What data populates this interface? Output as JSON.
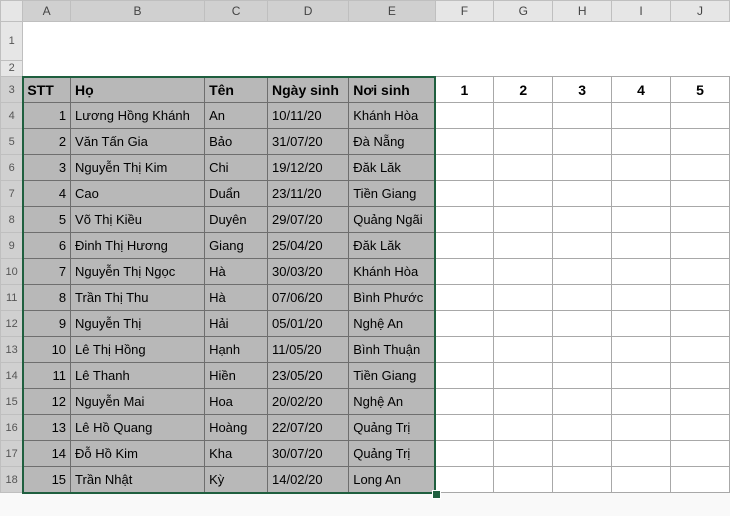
{
  "columns": [
    "A",
    "B",
    "C",
    "D",
    "E",
    "F",
    "G",
    "H",
    "I",
    "J"
  ],
  "header_row": {
    "stt": "STT",
    "ho": "Họ",
    "ten": "Tên",
    "ngaysinh": "Ngày sinh",
    "noisinh": "Nơi sinh",
    "extra": [
      "1",
      "2",
      "3",
      "4",
      "5"
    ]
  },
  "rows": [
    {
      "n": "1",
      "ho": "Lương Hồng Khánh",
      "ten": "An",
      "ns": "10/11/20",
      "noi": "Khánh Hòa"
    },
    {
      "n": "2",
      "ho": "Văn Tấn Gia",
      "ten": "Bảo",
      "ns": "31/07/20",
      "noi": "Đà Nẵng"
    },
    {
      "n": "3",
      "ho": "Nguyễn Thị Kim",
      "ten": "Chi",
      "ns": "19/12/20",
      "noi": "Đăk Lăk"
    },
    {
      "n": "4",
      "ho": "Cao",
      "ten": "Duẩn",
      "ns": "23/11/20",
      "noi": "Tiền Giang"
    },
    {
      "n": "5",
      "ho": "Võ Thị Kiều",
      "ten": "Duyên",
      "ns": "29/07/20",
      "noi": "Quảng Ngãi"
    },
    {
      "n": "6",
      "ho": "Đinh Thị Hương",
      "ten": "Giang",
      "ns": "25/04/20",
      "noi": "Đăk Lăk"
    },
    {
      "n": "7",
      "ho": "Nguyễn Thị Ngọc",
      "ten": "Hà",
      "ns": "30/03/20",
      "noi": "Khánh Hòa"
    },
    {
      "n": "8",
      "ho": "Trần Thị Thu",
      "ten": "Hà",
      "ns": "07/06/20",
      "noi": "Bình Phước"
    },
    {
      "n": "9",
      "ho": "Nguyễn Thị",
      "ten": "Hải",
      "ns": "05/01/20",
      "noi": "Nghệ An"
    },
    {
      "n": "10",
      "ho": "Lê Thị Hồng",
      "ten": "Hạnh",
      "ns": "11/05/20",
      "noi": "Bình Thuận"
    },
    {
      "n": "11",
      "ho": "Lê Thanh",
      "ten": "Hiền",
      "ns": "23/05/20",
      "noi": "Tiền Giang"
    },
    {
      "n": "12",
      "ho": "Nguyễn Mai",
      "ten": "Hoa",
      "ns": "20/02/20",
      "noi": "Nghệ An"
    },
    {
      "n": "13",
      "ho": "Lê Hồ Quang",
      "ten": "Hoàng",
      "ns": "22/07/20",
      "noi": "Quảng Trị"
    },
    {
      "n": "14",
      "ho": "Đỗ Hồ Kim",
      "ten": "Kha",
      "ns": "30/07/20",
      "noi": "Quảng Trị"
    },
    {
      "n": "15",
      "ho": "Trần Nhật",
      "ten": "Kỳ",
      "ns": "14/02/20",
      "noi": "Long An"
    }
  ],
  "row_numbers": [
    "1",
    "2",
    "3",
    "4",
    "5",
    "6",
    "7",
    "8",
    "9",
    "10",
    "11",
    "12",
    "13",
    "14",
    "15",
    "16",
    "17",
    "18"
  ]
}
